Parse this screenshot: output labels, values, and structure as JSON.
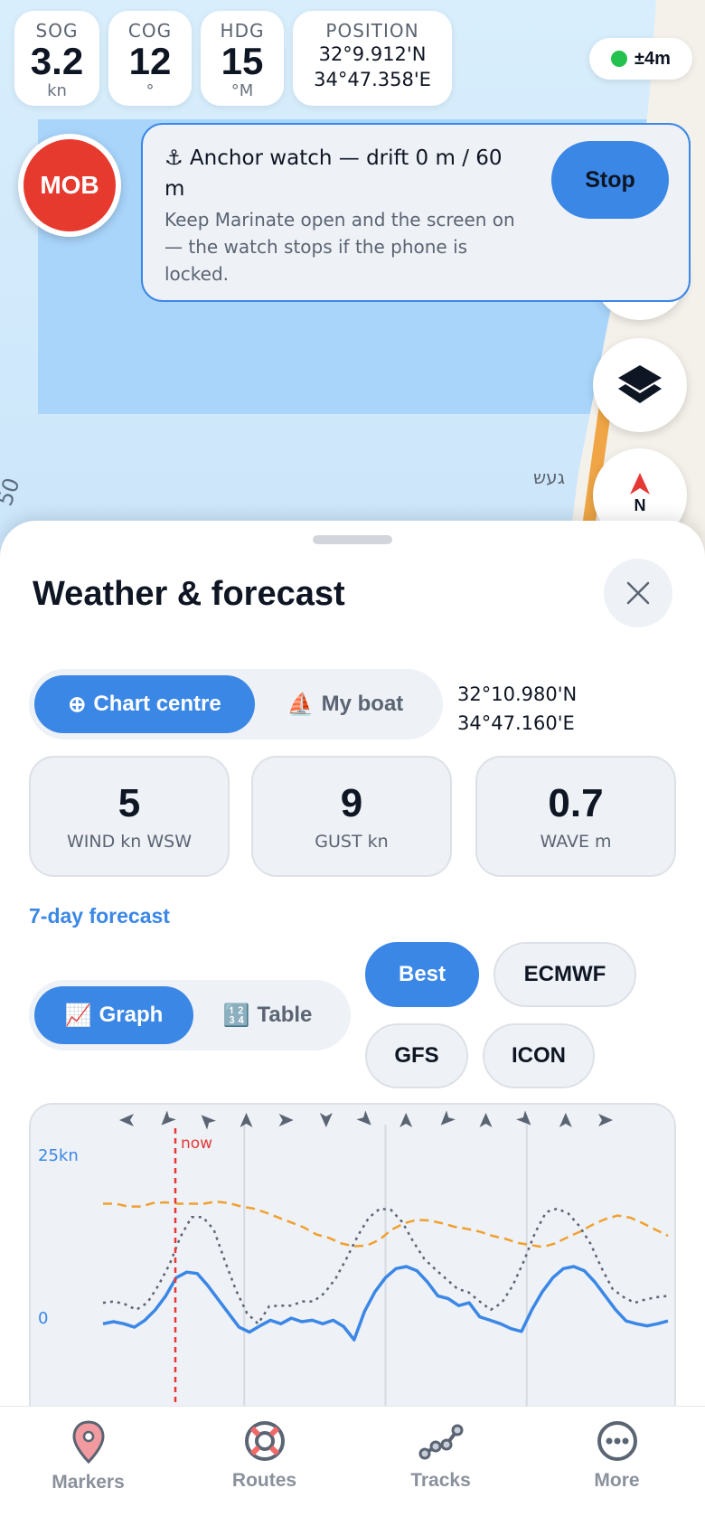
{
  "stats": {
    "sog": {
      "label": "SOG",
      "value": "3.2",
      "unit": "kn"
    },
    "cog": {
      "label": "COG",
      "value": "12",
      "unit": "°"
    },
    "hdg": {
      "label": "HDG",
      "value": "15",
      "unit": "°M"
    },
    "position": {
      "label": "POSITION",
      "lat": "32°9.912'N",
      "lon": "34°47.358'E"
    }
  },
  "gps_accuracy": "±4m",
  "map": {
    "place_label": "געש",
    "edge_label": "50"
  },
  "mob_label": "MOB",
  "anchor_watch": {
    "title": "⚓ Anchor watch — drift 0 m / 60 m",
    "description": "Keep Marinate open and the screen on — the watch stops if the phone is locked.",
    "stop_label": "Stop"
  },
  "compass_label": "N",
  "sheet": {
    "title": "Weather & forecast",
    "location_options": [
      {
        "icon": "⊕",
        "label": "Chart centre",
        "selected": true
      },
      {
        "icon": "⛵",
        "label": "My boat",
        "selected": false
      }
    ],
    "coords": {
      "lat": "32°10.980'N",
      "lon": "34°47.160'E"
    },
    "cards": [
      {
        "value": "5",
        "label": "WIND kn WSW"
      },
      {
        "value": "9",
        "label": "GUST kn"
      },
      {
        "value": "0.7",
        "label": "WAVE m"
      }
    ],
    "forecast_link": "7-day forecast",
    "view_options": [
      {
        "icon": "📈",
        "label": "Graph",
        "selected": true
      },
      {
        "icon": "🔢",
        "label": "Table",
        "selected": false
      }
    ],
    "models": [
      {
        "label": "Best",
        "selected": true
      },
      {
        "label": "ECMWF",
        "selected": false
      },
      {
        "label": "GFS",
        "selected": false
      },
      {
        "label": "ICON",
        "selected": false
      }
    ]
  },
  "chart_data": {
    "type": "line",
    "y_tick_labels": [
      "25kn",
      "0"
    ],
    "ylim": [
      0,
      25
    ],
    "now_label": "now",
    "now_index": 3,
    "day_divider_indices": [
      11,
      22,
      33
    ],
    "colors": {
      "wind": "#3b87e6",
      "gust": "#5b6472",
      "wave": "#f0a030",
      "now": "#e53935"
    },
    "wind": [
      1,
      1.3,
      1,
      0.5,
      1.5,
      3,
      5,
      7.6,
      8.4,
      8.2,
      6.5,
      4.5,
      2.5,
      0.5,
      -0.2,
      0.7,
      1.5,
      1,
      1.8,
      1.3,
      1.5,
      1,
      1.5,
      0.6,
      -1.3,
      2.8,
      5.6,
      7.6,
      8.9,
      9.2,
      8.6,
      7,
      5,
      4.6,
      3.6,
      4,
      2,
      1.5,
      1,
      0.3,
      -0.1,
      3,
      5.6,
      7.6,
      8.9,
      9.2,
      8.6,
      7,
      5,
      3,
      1.4,
      1,
      0.7,
      1,
      1.4
    ],
    "gust": [
      4,
      4.2,
      3.8,
      3,
      4,
      6.5,
      9.5,
      13.5,
      16.3,
      16.3,
      14.5,
      10,
      5.8,
      2.5,
      1,
      3.5,
      3.6,
      3.6,
      4.2,
      4.2,
      5.4,
      7.5,
      10.4,
      13.6,
      16.2,
      17.5,
      17.3,
      15.6,
      12.8,
      10.3,
      8.8,
      7.4,
      6,
      5.5,
      4.2,
      3,
      4,
      6.5,
      10,
      14,
      17,
      17.5,
      16.8,
      15,
      12.5,
      9,
      6,
      4.8,
      4,
      4.5,
      4.8,
      5
    ],
    "wave": [
      18.2,
      18.2,
      17.8,
      17.8,
      18.3,
      18.4,
      18.2,
      18.2,
      18.2,
      18.5,
      18.3,
      17.8,
      17.5,
      16.9,
      16.2,
      15.5,
      14.8,
      13.8,
      13.3,
      12.5,
      12.1,
      12.2,
      13,
      14.5,
      15.4,
      15.9,
      15.8,
      15.4,
      14.9,
      14.6,
      14.2,
      13.6,
      13.2,
      12.6,
      12.3,
      12,
      12.5,
      13.4,
      14.2,
      15.2,
      16,
      16.5,
      16.2,
      15.4,
      14.5,
      13.6
    ],
    "wind_direction_arrows": [
      "W",
      "SW",
      "NW",
      "N",
      "E",
      "S",
      "SE",
      "N",
      "SW",
      "N",
      "SE",
      "N",
      "E"
    ]
  },
  "tabs": [
    {
      "label": "Markers",
      "icon": "map-pin-icon"
    },
    {
      "label": "Routes",
      "icon": "life-ring-icon"
    },
    {
      "label": "Tracks",
      "icon": "track-icon"
    },
    {
      "label": "More",
      "icon": "more-icon"
    }
  ]
}
